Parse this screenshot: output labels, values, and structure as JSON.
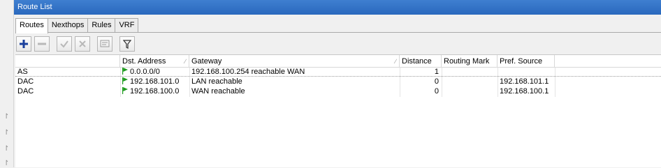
{
  "window": {
    "title": "Route List"
  },
  "tabs": [
    {
      "label": "Routes",
      "active": true
    },
    {
      "label": "Nexthops",
      "active": false
    },
    {
      "label": "Rules",
      "active": false
    },
    {
      "label": "VRF",
      "active": false
    }
  ],
  "toolbar": {
    "icons": [
      "add-icon",
      "remove-icon",
      "enable-icon",
      "disable-icon",
      "comment-icon",
      "filter-icon"
    ],
    "colors": {
      "add": "#1a3f9c",
      "flag": "#1e9b1e"
    }
  },
  "columns": {
    "type": "",
    "dst": "Dst. Address",
    "gateway": "Gateway",
    "distance": "Distance",
    "routing_mark": "Routing Mark",
    "pref_source": "Pref. Source"
  },
  "rows": [
    {
      "type": "AS",
      "dst": "0.0.0.0/0",
      "gateway": "192.168.100.254 reachable WAN",
      "distance": "1",
      "routing_mark": "",
      "pref_source": ""
    },
    {
      "type": "DAC",
      "dst": "192.168.101.0",
      "gateway": "LAN reachable",
      "distance": "0",
      "routing_mark": "",
      "pref_source": "192.168.101.1"
    },
    {
      "type": "DAC",
      "dst": "192.168.100.0",
      "gateway": "WAN reachable",
      "distance": "0",
      "routing_mark": "",
      "pref_source": "192.168.100.1"
    }
  ]
}
